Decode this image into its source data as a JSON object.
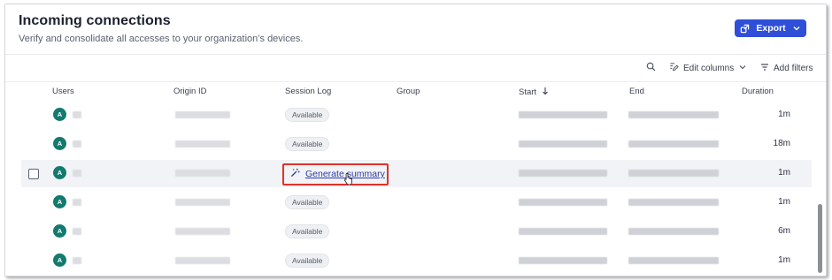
{
  "header": {
    "title": "Incoming connections",
    "subtitle": "Verify and consolidate all accesses to your organization’s devices."
  },
  "toolbar": {
    "export_label": "Export",
    "edit_columns_label": "Edit columns",
    "add_filters_label": "Add filters"
  },
  "table": {
    "columns": [
      "Users",
      "Origin ID",
      "Session Log",
      "Group",
      "Start",
      "End",
      "Duration"
    ],
    "sort_column": "Start",
    "rows": [
      {
        "avatar": "A",
        "session_log": "Available",
        "duration": "1m"
      },
      {
        "avatar": "A",
        "session_log": "Available",
        "duration": "18m"
      },
      {
        "avatar": "A",
        "session_log": "Generate summary",
        "duration": "1m"
      },
      {
        "avatar": "A",
        "session_log": "Available",
        "duration": "1m"
      },
      {
        "avatar": "A",
        "session_log": "Available",
        "duration": "6m"
      },
      {
        "avatar": "A",
        "session_log": "Available",
        "duration": "1m"
      }
    ]
  },
  "colors": {
    "accent": "#2f4fd8",
    "avatar_bg": "#127a6e",
    "highlight_box": "#e0312b",
    "link": "#2b3aa8"
  }
}
